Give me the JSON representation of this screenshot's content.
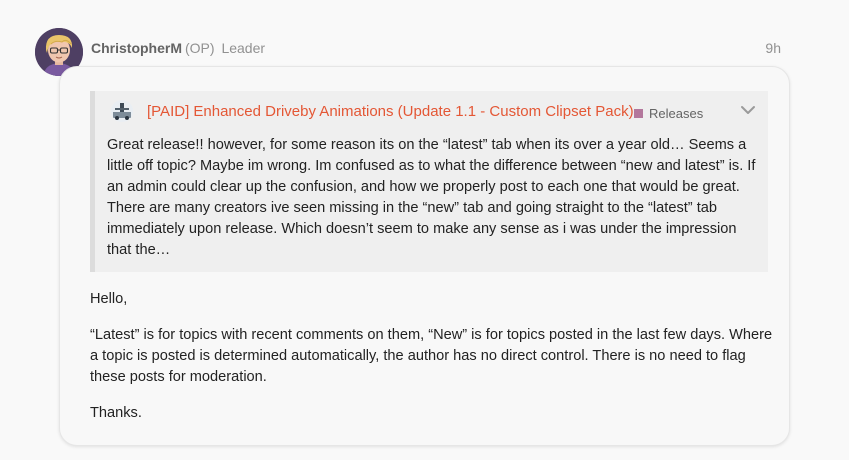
{
  "post": {
    "username": "ChristopherM",
    "op_tag": "(OP)",
    "user_title": "Leader",
    "date": "9h"
  },
  "quote": {
    "topic_title": "[PAID] Enhanced Driveby Animations (Update 1.1 - Custom Clipset Pack)",
    "category": "Releases",
    "category_color": "#b3779c",
    "text": "Great release!! however, for some reason its on the “latest” tab when its over a year old… Seems a little off topic? Maybe im wrong. Im confused as to what the difference between “new and latest” is. If an admin could clear up the confusion, and how we properly post to each one that would be great. There are many creators ive seen missing in the “new” tab and going straight to the “latest” tab immediately upon release. Which doesn’t seem to make any sense as i was under the impression that the…"
  },
  "body": {
    "greeting": "Hello,",
    "paragraph": "“Latest” is for topics with recent comments on them, “New” is for topics posted in the last few days. Where a topic is posted is determined automatically, the author has no direct control. There is no need to flag these posts for moderation.",
    "signoff": "Thanks."
  },
  "colors": {
    "link": "#e45735",
    "muted": "#919191"
  },
  "icons": {
    "expand": "chevron-down-icon"
  }
}
